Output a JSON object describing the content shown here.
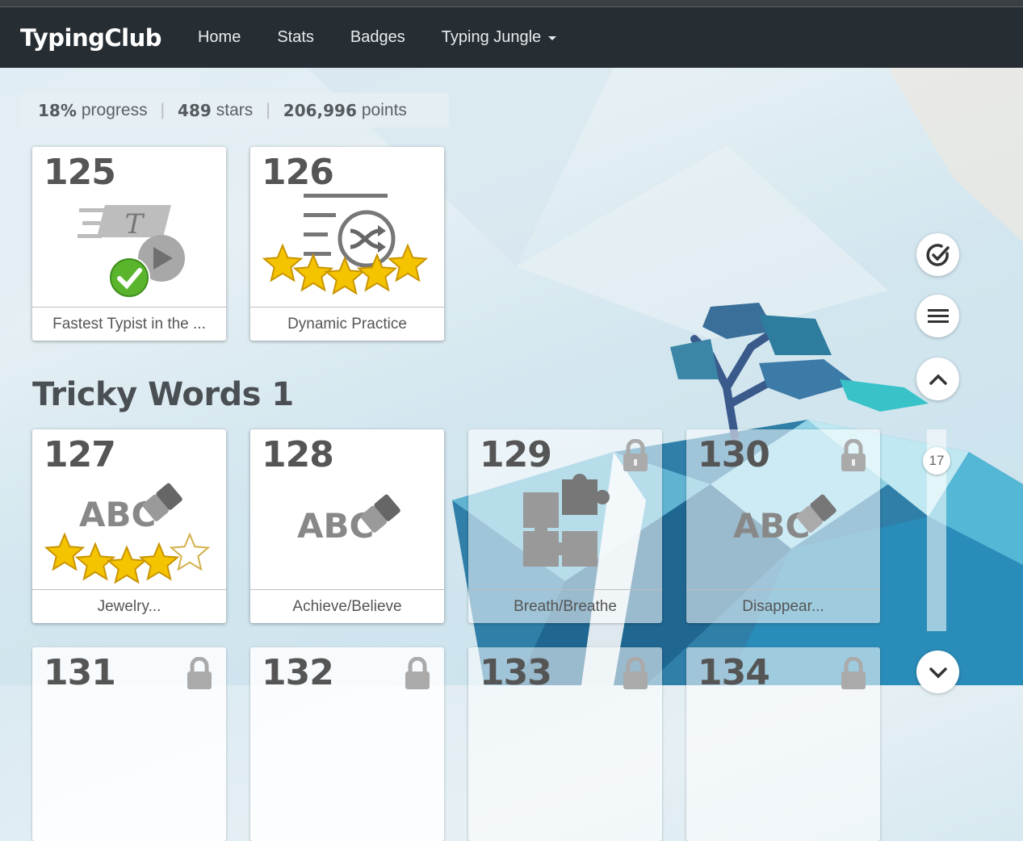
{
  "nav": {
    "brand": "TypingClub",
    "links": [
      "Home",
      "Stats",
      "Badges"
    ],
    "dropdown": "Typing Jungle"
  },
  "progress": {
    "percent": "18%",
    "percent_label": "progress",
    "stars": "489",
    "stars_label": "stars",
    "points": "206,996",
    "points_label": "points",
    "separator": "|"
  },
  "section": {
    "title": "Tricky Words 1"
  },
  "cards": [
    {
      "num": "125",
      "title": "Fastest Typist in the ...",
      "stars": 0,
      "completed": true,
      "locked": false
    },
    {
      "num": "126",
      "title": "Dynamic Practice",
      "stars": 5,
      "completed": false,
      "locked": false
    },
    {
      "num": "127",
      "title": "Jewelry...",
      "stars": 4,
      "locked": false
    },
    {
      "num": "128",
      "title": "Achieve/Believe",
      "stars": 0,
      "locked": false
    },
    {
      "num": "129",
      "title": "Breath/Breathe",
      "stars": 0,
      "locked": true
    },
    {
      "num": "130",
      "title": "Disappear...",
      "stars": 0,
      "locked": true
    },
    {
      "num": "131",
      "locked": true
    },
    {
      "num": "132",
      "locked": true
    },
    {
      "num": "133",
      "locked": true
    },
    {
      "num": "134",
      "locked": true
    }
  ],
  "icon_text": {
    "abc": "ABC",
    "typed_t": "T"
  },
  "scroll": {
    "position": "17"
  },
  "colors": {
    "navbar": "#262d33",
    "star": "#f5c400",
    "check": "#5ab52d"
  }
}
